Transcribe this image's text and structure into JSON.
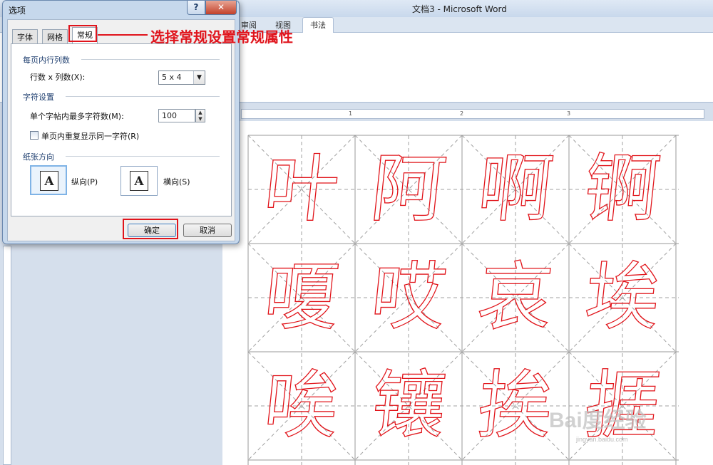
{
  "window": {
    "title": "文档3 - Microsoft Word"
  },
  "ribbon": {
    "tabs": [
      {
        "label": "审阅"
      },
      {
        "label": "视图"
      },
      {
        "label": "书法"
      }
    ]
  },
  "ruler": {
    "marks": [
      "1",
      "2",
      "3"
    ]
  },
  "document": {
    "characters": [
      "叶",
      "阿",
      "啊",
      "锕",
      "嗄",
      "哎",
      "哀",
      "埃",
      "唉",
      "镶",
      "挨",
      "捱"
    ],
    "watermark": "Bai度经验",
    "watermark_sub": "jingyan.baidu.com"
  },
  "dialog": {
    "title": "选项",
    "help_label": "?",
    "close_label": "✕",
    "tabs": [
      {
        "label": "字体"
      },
      {
        "label": "网格"
      },
      {
        "label": "常规"
      }
    ],
    "group_rows": {
      "title": "每页内行列数",
      "field_label": "行数 x 列数(X):",
      "value": "5 x 4"
    },
    "group_chars": {
      "title": "字符设置",
      "max_label": "单个字帖内最多字符数(M):",
      "max_value": "100",
      "repeat_label": "单页内重复显示同一字符(R)"
    },
    "group_orientation": {
      "title": "纸张方向",
      "portrait_label": "纵向(P)",
      "landscape_label": "横向(S)",
      "icon_letter": "A"
    },
    "ok_label": "确定",
    "cancel_label": "取消"
  },
  "annotation": {
    "text": "选择常规设置常规属性",
    "color": "#e0141c"
  }
}
